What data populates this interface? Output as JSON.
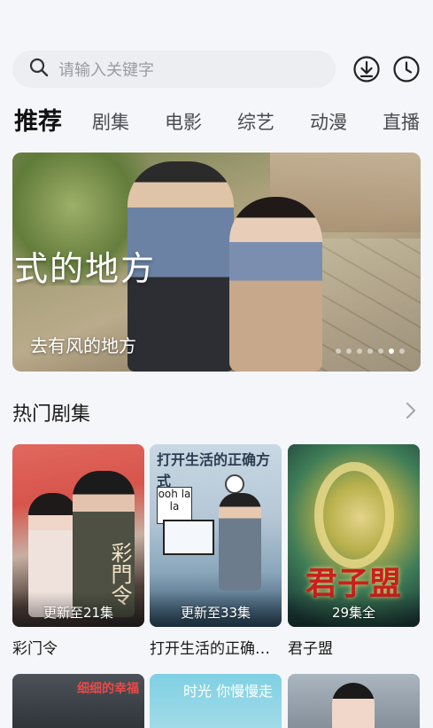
{
  "search": {
    "placeholder": "请输入关键字"
  },
  "tabs": [
    {
      "label": "推荐",
      "active": true
    },
    {
      "label": "剧集",
      "active": false
    },
    {
      "label": "电影",
      "active": false
    },
    {
      "label": "综艺",
      "active": false
    },
    {
      "label": "动漫",
      "active": false
    },
    {
      "label": "直播",
      "active": false
    }
  ],
  "banner": {
    "overlay_title": "的地方",
    "overlay_prefix": "式",
    "caption": "去有风的地方",
    "dot_count": 7,
    "active_dot": 5
  },
  "section": {
    "title": "热门剧集"
  },
  "cards": [
    {
      "title": "彩门令",
      "badge": "更新至21集",
      "poster_text": "彩門令"
    },
    {
      "title": "打开生活的正确…",
      "badge": "更新至33集",
      "poster_text": "打开生活的正确方式",
      "poster_sub": "ooh la la"
    },
    {
      "title": "君子盟",
      "badge": "29集全",
      "poster_text": "君子盟"
    }
  ],
  "row2": [
    {
      "poster_text": "细细的幸福"
    },
    {
      "poster_text": "时光 你慢慢走"
    },
    {
      "poster_text": ""
    }
  ],
  "icons": {
    "search": "search-icon",
    "download": "download-icon",
    "history": "history-clock-icon",
    "more": "chevron-right-icon"
  },
  "colors": {
    "background": "#f5f6fa",
    "search_bg": "#eceef2",
    "text_primary": "#1a1a1a",
    "text_secondary": "#4a4b50"
  }
}
